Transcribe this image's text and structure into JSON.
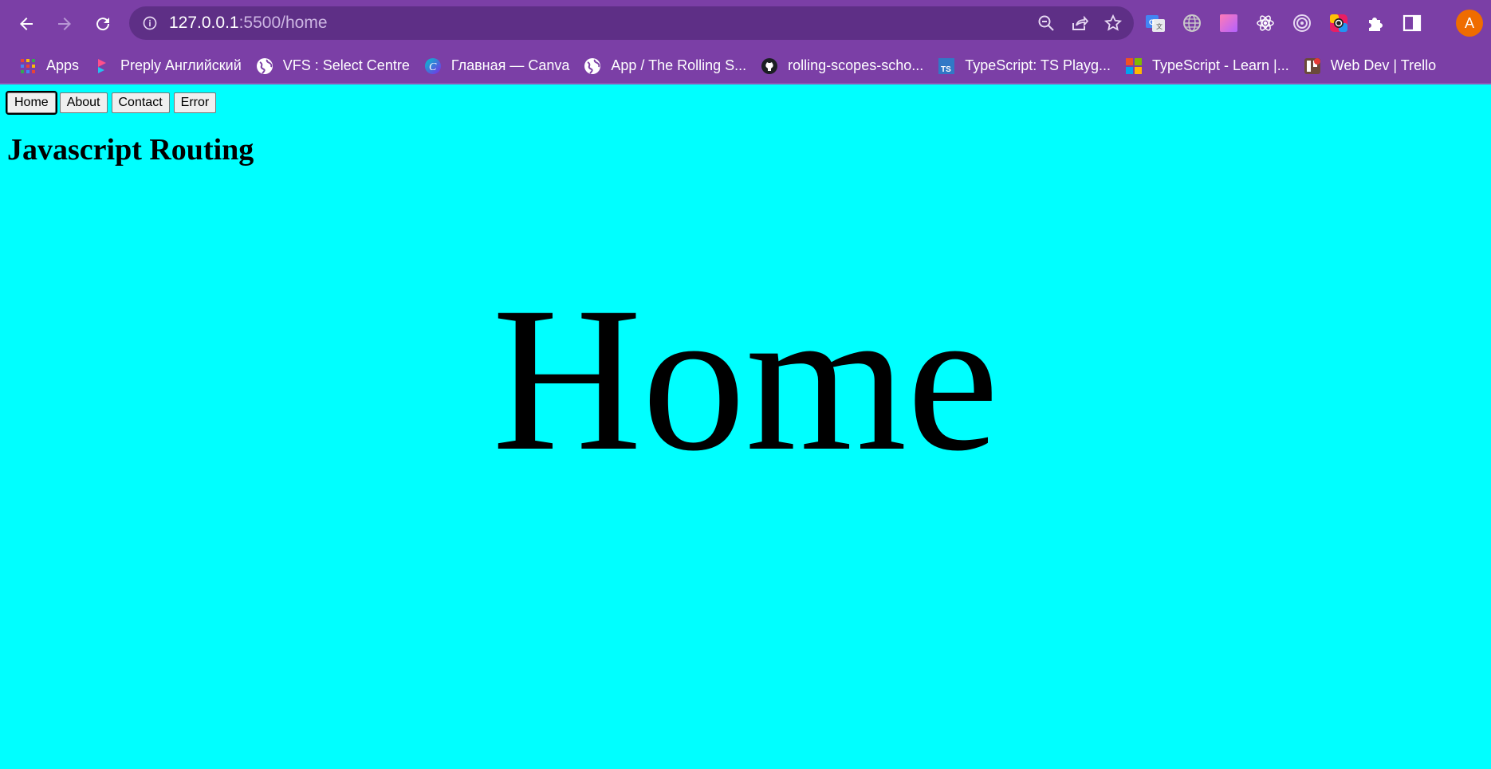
{
  "browser": {
    "url_host": "127.0.0.1",
    "url_rest": ":5500/home",
    "avatar_letter": "A",
    "bookmarks": [
      {
        "label": "Apps",
        "icon": "apps-grid-icon"
      },
      {
        "label": "Preply Английский",
        "icon": "preply-icon"
      },
      {
        "label": "VFS : Select Centre",
        "icon": "globe-icon"
      },
      {
        "label": "Главная — Canva",
        "icon": "canva-icon"
      },
      {
        "label": "App / The Rolling S...",
        "icon": "globe-icon"
      },
      {
        "label": "rolling-scopes-scho...",
        "icon": "github-icon"
      },
      {
        "label": "TypeScript: TS Playg...",
        "icon": "typescript-icon"
      },
      {
        "label": "TypeScript - Learn |...",
        "icon": "microsoft-icon"
      },
      {
        "label": "Web Dev | Trello",
        "icon": "trello-icon"
      }
    ],
    "extensions": [
      "google-translate-icon",
      "globe-extension-icon",
      "gradient-extension-icon",
      "react-devtools-icon",
      "target-extension-icon",
      "color-picker-icon",
      "puzzle-extensions-icon",
      "side-panel-icon"
    ],
    "colors": {
      "chrome": "#7b3fa6",
      "omnibox": "#5e2f86",
      "avatar": "#ef6c00"
    }
  },
  "page": {
    "background": "#00ffff",
    "nav_buttons": [
      "Home",
      "About",
      "Contact",
      "Error"
    ],
    "active_route": "Home",
    "heading": "Javascript Routing",
    "content": "Home"
  }
}
